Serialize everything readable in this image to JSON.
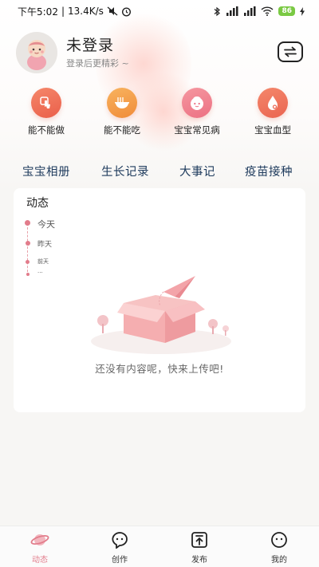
{
  "status_bar": {
    "time": "下午5:02",
    "speed": "13.4K/s",
    "battery": "86"
  },
  "profile": {
    "name": "未登录",
    "subtitle": "登录后更精彩 ~"
  },
  "features": [
    {
      "label": "能不能做",
      "icon": "hand-tap-icon",
      "color": "#ef6f55"
    },
    {
      "label": "能不能吃",
      "icon": "noodle-bowl-icon",
      "color": "#f4a04a"
    },
    {
      "label": "宝宝常见病",
      "icon": "baby-face-icon",
      "color": "#f07f8a"
    },
    {
      "label": "宝宝血型",
      "icon": "blood-drop-icon",
      "color": "#ef7a5f"
    }
  ],
  "tabs": [
    "宝宝相册",
    "生长记录",
    "大事记",
    "疫苗接种"
  ],
  "feed": {
    "title": "动态",
    "timeline": [
      "今天",
      "昨天",
      "前天",
      "..."
    ],
    "empty_text": "还没有内容呢，快来上传吧!"
  },
  "bottom_nav": [
    {
      "label": "动态",
      "icon": "planet-icon",
      "active": true
    },
    {
      "label": "创作",
      "icon": "chat-bubble-icon",
      "active": false
    },
    {
      "label": "发布",
      "icon": "upload-icon",
      "active": false
    },
    {
      "label": "我的",
      "icon": "smiley-icon",
      "active": false
    }
  ],
  "colors": {
    "accent": "#e27c8b",
    "tab_text": "#1d3a5c",
    "background": "#f7f6f4"
  }
}
